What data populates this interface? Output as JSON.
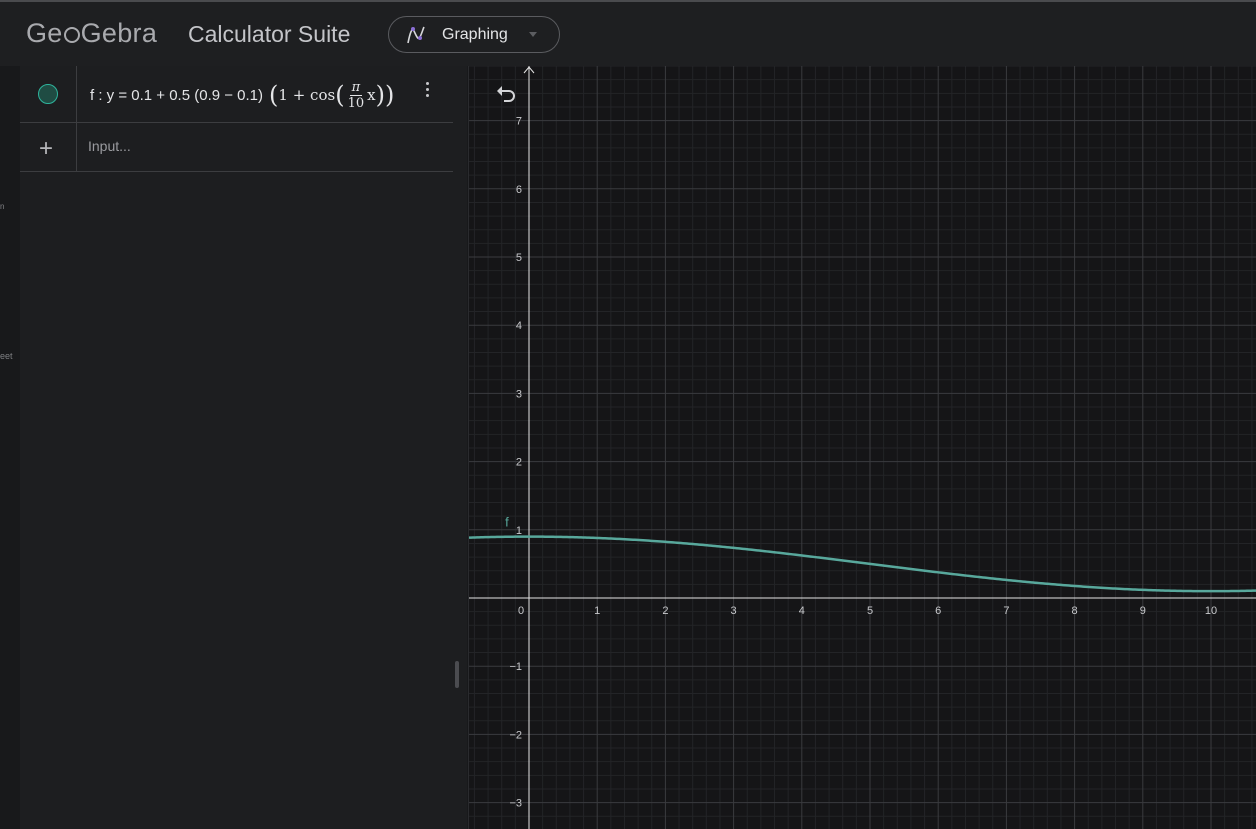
{
  "header": {
    "logo": {
      "before": "Ge",
      "after": "Gebra"
    },
    "suite_title": "Calculator Suite",
    "app_selector": {
      "label": "Graphing",
      "icon": "graphing-icon"
    }
  },
  "side_strip": {
    "label_top": "n",
    "label_mid": "eet"
  },
  "algebra": {
    "row1": {
      "lhs": "f : y = 0.1 + 0.5 (0.9 − 0.1)",
      "inner_start": "1 + cos",
      "frac_num": "π",
      "frac_den": "10",
      "var": "x"
    },
    "input_placeholder": "Input..."
  },
  "graph": {
    "x_ticks": [
      0,
      1,
      2,
      3,
      4,
      5,
      6,
      7,
      8,
      9,
      10
    ],
    "y_ticks": [
      -3,
      -2,
      -1,
      1,
      2,
      3,
      4,
      5,
      6,
      7
    ],
    "function_label": "f",
    "curve_color": "#58a89c",
    "grid_color": "#3a3b3f",
    "minor_grid_color": "#232427",
    "axis_color": "#e5e5e5"
  }
}
